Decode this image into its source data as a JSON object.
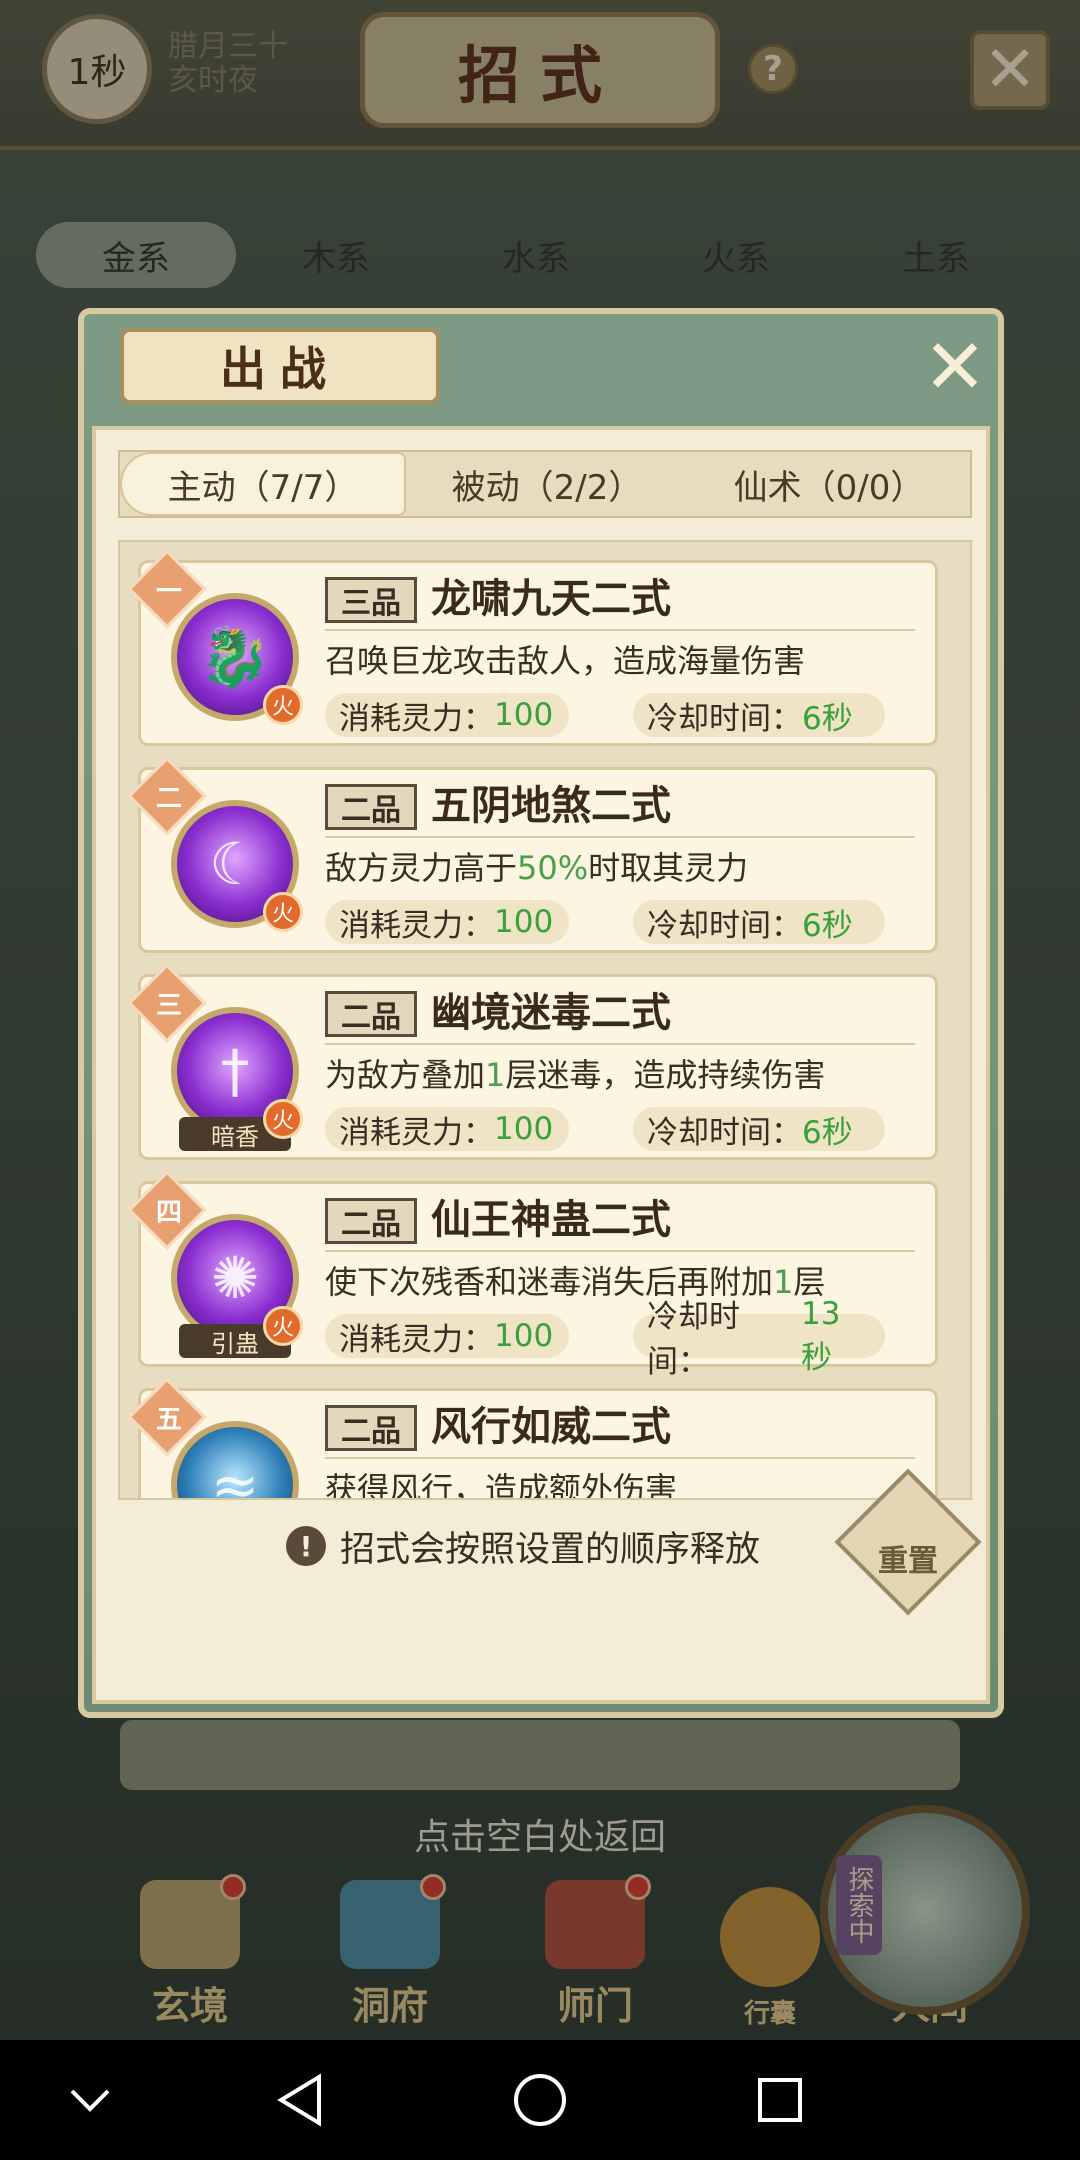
{
  "top_bar": {
    "timer": "1秒",
    "date_line1": "腊月三十",
    "date_line2": "亥时夜",
    "title": "招式",
    "help": "?"
  },
  "element_tabs": [
    "金系",
    "木系",
    "水系",
    "火系",
    "土系"
  ],
  "modal": {
    "title": "出战",
    "sub_tabs": [
      "主动（7/7）",
      "被动（2/2）",
      "仙术（0/0）"
    ],
    "skills": [
      {
        "rank": "一",
        "grade": "三品",
        "name": "龙啸九天二式",
        "desc_parts": [
          "召唤巨龙攻击敌人，造成海量伤害",
          "",
          ""
        ],
        "cost_label": "消耗灵力：",
        "cost": "100",
        "cd_label": "冷却时间：",
        "cd": "6秒",
        "element": "火",
        "icon_label": "",
        "icon": "dragon-icon",
        "icon_color": "purple"
      },
      {
        "rank": "二",
        "grade": "二品",
        "name": "五阴地煞二式",
        "desc_parts": [
          "敌方灵力高于",
          "50%",
          "时取其灵力"
        ],
        "cost_label": "消耗灵力：",
        "cost": "100",
        "cd_label": "冷却时间：",
        "cd": "6秒",
        "element": "火",
        "icon_label": "",
        "icon": "ghost-icon",
        "icon_color": "purple"
      },
      {
        "rank": "三",
        "grade": "二品",
        "name": "幽境迷毒二式",
        "desc_parts": [
          "为敌方叠加",
          "1",
          "层迷毒，造成持续伤害"
        ],
        "cost_label": "消耗灵力：",
        "cost": "100",
        "cd_label": "冷却时间：",
        "cd": "6秒",
        "element": "火",
        "icon_label": "暗香",
        "icon": "sword-icon",
        "icon_color": "purple"
      },
      {
        "rank": "四",
        "grade": "二品",
        "name": "仙王神蛊二式",
        "desc_parts": [
          "使下次残香和迷毒消失后再附加",
          "1",
          "层"
        ],
        "cost_label": "消耗灵力：",
        "cost": "100",
        "cd_label": "冷却时间：",
        "cd": "13秒",
        "element": "火",
        "icon_label": "引蛊",
        "icon": "scorpion-icon",
        "icon_color": "purple"
      },
      {
        "rank": "五",
        "grade": "二品",
        "name": "风行如威二式",
        "desc_parts": [
          "获得风行，造成额外伤害",
          "",
          ""
        ],
        "cost_label": "",
        "cost": "",
        "cd_label": "",
        "cd": "",
        "element": "",
        "icon_label": "",
        "icon": "wind-icon",
        "icon_color": "blue"
      }
    ],
    "hint": "招式会按照设置的顺序释放",
    "hint_icon": "!",
    "reset_label": "重置"
  },
  "return_hint": "点击空白处返回",
  "bottom_nav": {
    "items": [
      "玄境",
      "洞府",
      "师门",
      "人间"
    ],
    "explore_badge": "探索中",
    "bag_label": "行囊"
  }
}
